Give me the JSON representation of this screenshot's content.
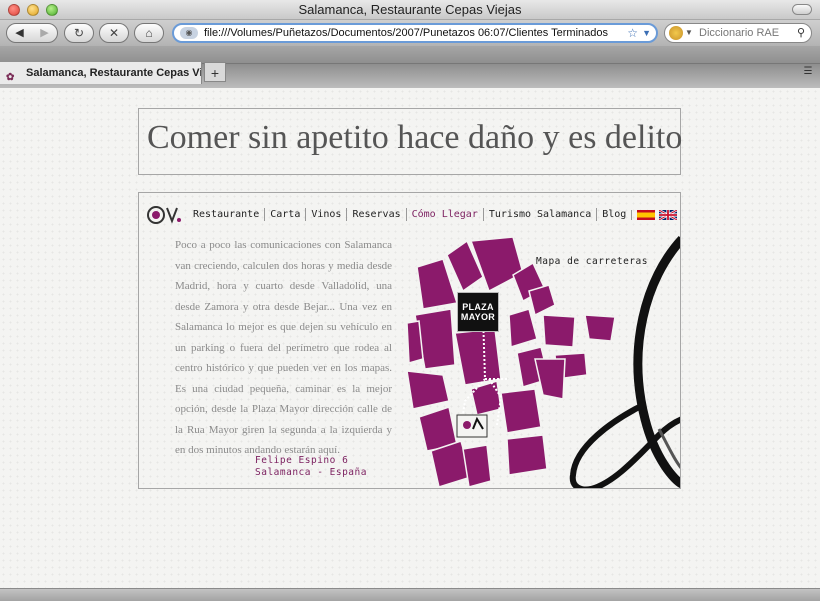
{
  "window": {
    "title": "Salamanca, Restaurante Cepas Viejas"
  },
  "toolbar": {
    "url": "file:///Volumes/Puñetazos/Documentos/2007/Punetazos 06:07/Clientes Terminados",
    "search_placeholder": "Diccionario RAE"
  },
  "tabs": [
    {
      "label": "Salamanca, Restaurante Cepas Vie..."
    }
  ],
  "page": {
    "headline": "Comer sin apetito hace daño y es delito",
    "nav": [
      {
        "label": "Restaurante"
      },
      {
        "label": "Carta"
      },
      {
        "label": "Vinos"
      },
      {
        "label": "Reservas"
      },
      {
        "label": "Cómo Llegar",
        "active": true
      },
      {
        "label": "Turismo Salamanca"
      },
      {
        "label": "Blog"
      }
    ],
    "body_text": "Poco a poco las comunicaciones con Salamanca van creciendo, calculen dos horas y media desde Madrid, hora y cuarto desde Valladolid, una desde Zamora y otra desde Bejar... Una vez en Salamanca lo mejor es que dejen su vehículo en un parking o fuera del perímetro que rodea al centro histórico y que pueden ver en los mapas. Es una ciudad pequeña, caminar es la mejor opción, desde la Plaza Mayor dirección calle de la Rua Mayor giren la segunda a la izquierda y en dos minutos andando estarán aquí.",
    "address_line1": "Felipe Espino 6",
    "address_line2": "Salamanca - España",
    "map_link": "Mapa de carreteras",
    "plaza_line1": "PLAZA",
    "plaza_line2": "MAYOR"
  },
  "colors": {
    "accent": "#7b1f5f",
    "block": "#8b1a6b",
    "url_border": "#6a9bd8"
  }
}
